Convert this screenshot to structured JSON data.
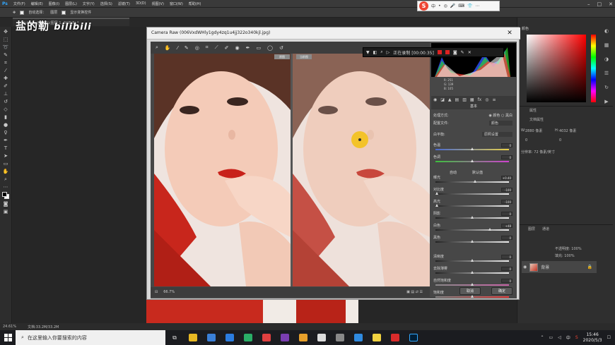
{
  "app": {
    "logo": "Ps",
    "menu": [
      "文件(F)",
      "编辑(E)",
      "图像(I)",
      "图层(L)",
      "文字(Y)",
      "选择(S)",
      "滤镜(T)",
      "3D(D)",
      "视图(V)",
      "窗口(W)",
      "帮助(H)"
    ],
    "options": {
      "auto_select_label": "自动选择：",
      "auto_select_value": "图层",
      "transform_label": "显示变换控件"
    },
    "doc_tab": "...74cA.jpg @ 25%(图层 1, RGB/8) *"
  },
  "watermark": {
    "text": "盐的勒",
    "brand": "bilibili"
  },
  "camera_raw": {
    "title": "Camera Raw (006VxdWHly1gdy4zq1u4jj322o340kjl.jpg)",
    "close": "✕",
    "recording": "正在录制 [00:00:35]",
    "before_tag": "原图",
    "after_tag": "当前图",
    "zoom": "66.7%",
    "rgb": {
      "r": "R: 251",
      "g": "G: 139",
      "b": "B: 105"
    },
    "panel_title": "基本",
    "treatment_label": "处理方式:",
    "treatment_color": "颜色",
    "treatment_bw": "黑白",
    "profile_label": "配置文件:",
    "profile_value": "颜色",
    "wb_label": "白平衡:",
    "wb_value": "原照设置",
    "auto": "自动",
    "default": "默认值",
    "sliders": [
      {
        "label": "色温",
        "value": "0",
        "pos": 0.5,
        "grad": "linear-gradient(90deg,#4a6ad0,#e8d048)"
      },
      {
        "label": "色调",
        "value": "0",
        "pos": 0.5,
        "grad": "linear-gradient(90deg,#3cc03c,#d040d0)"
      },
      {
        "label": "曝光",
        "value": "+0.40",
        "pos": 0.54,
        "grad": "linear-gradient(90deg,#222,#eee)"
      },
      {
        "label": "对比度",
        "value": "-100",
        "pos": 0.02,
        "grad": "linear-gradient(90deg,#222,#eee)"
      },
      {
        "label": "高光",
        "value": "-100",
        "pos": 0.02,
        "grad": "linear-gradient(90deg,#222,#eee)"
      },
      {
        "label": "阴影",
        "value": "0",
        "pos": 0.5,
        "grad": "linear-gradient(90deg,#222,#eee)"
      },
      {
        "label": "白色",
        "value": "+48",
        "pos": 0.74,
        "grad": "linear-gradient(90deg,#222,#eee)"
      },
      {
        "label": "黑色",
        "value": "0",
        "pos": 0.5,
        "grad": "linear-gradient(90deg,#222,#eee)"
      },
      {
        "label": "清晰度",
        "value": "0",
        "pos": 0.5,
        "grad": "linear-gradient(90deg,#222,#eee)"
      },
      {
        "label": "去除薄雾",
        "value": "0",
        "pos": 0.5,
        "grad": "linear-gradient(90deg,#222,#eee)"
      },
      {
        "label": "自然饱和度",
        "value": "0",
        "pos": 0.5,
        "grad": "linear-gradient(90deg,#888,#c6a)"
      },
      {
        "label": "饱和度",
        "value": "0",
        "pos": 0.5,
        "grad": "linear-gradient(90deg,#888,#e44)"
      }
    ],
    "cancel": "取消",
    "ok": "确定"
  },
  "right_panel": {
    "color_tab": "颜色",
    "props_tab": "属性",
    "adjust_tab": "调整",
    "doc_props": "文档属性",
    "w_label": "W:",
    "w_value": "2880 像素",
    "h_label": "H:",
    "h_value": "4032 像素",
    "x_value": "0",
    "y_value": "0",
    "res": "分辨率: 72 像素/英寸",
    "layers_tab": "图层",
    "channels_tab": "通道",
    "opacity": "不透明度: 100%",
    "fill": "填充: 100%",
    "layer_name": "背景"
  },
  "status": {
    "zoom": "24.61%",
    "doc": "文档:33.2M/33.2M"
  },
  "ime": {
    "logo": "S",
    "lang": "中",
    "items": [
      "•",
      "◎",
      "🎤",
      "⌨",
      "👕",
      "⋯"
    ]
  },
  "taskbar": {
    "search_placeholder": "在这里输入你要搜索的内容",
    "apps": [
      {
        "name": "explorer",
        "color": "#e8b923"
      },
      {
        "name": "mail",
        "color": "#3a80d8"
      },
      {
        "name": "wps",
        "color": "#2b7de1"
      },
      {
        "name": "wechat",
        "color": "#2aae67"
      },
      {
        "name": "weibo",
        "color": "#e04040"
      },
      {
        "name": "onenote",
        "color": "#7a3eb0"
      },
      {
        "name": "chrome",
        "color": "#e7a02b"
      },
      {
        "name": "compass",
        "color": "#dcdcdc"
      },
      {
        "name": "tools",
        "color": "#888888"
      },
      {
        "name": "browser",
        "color": "#2f8ae0"
      },
      {
        "name": "notes",
        "color": "#f0d240"
      },
      {
        "name": "recorder",
        "color": "#d92b2b"
      },
      {
        "name": "photoshop",
        "color": "#31a8ff"
      }
    ],
    "time": "15:46",
    "date": "2020/5/3",
    "ime_lang": "中"
  }
}
